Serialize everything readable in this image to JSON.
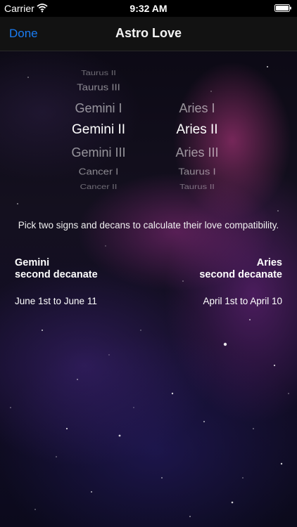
{
  "status_bar": {
    "carrier": "Carrier",
    "time": "9:32 AM"
  },
  "nav": {
    "done_label": "Done",
    "title": "Astro Love"
  },
  "picker": {
    "left_column": [
      "Taurus II",
      "Taurus III",
      "Gemini I",
      "Gemini II",
      "Gemini III",
      "Cancer I",
      "Cancer II"
    ],
    "left_selected": "Gemini II",
    "right_column": [
      "",
      "",
      "Aries I",
      "Aries II",
      "Aries III",
      "Taurus I",
      "Taurus II"
    ],
    "right_selected": "Aries II"
  },
  "instructions": "Pick two signs and decans to calculate their love compatibility.",
  "left_sign": {
    "name": "Gemini",
    "decanate": "second decanate",
    "dates": "June 1st to June 11"
  },
  "right_sign": {
    "name": "Aries",
    "decanate": "second decanate",
    "dates": "April 1st to April 10"
  },
  "colors": {
    "accent": "#1a7cf2",
    "nav_background": "#121212",
    "status_background": "#000000"
  }
}
